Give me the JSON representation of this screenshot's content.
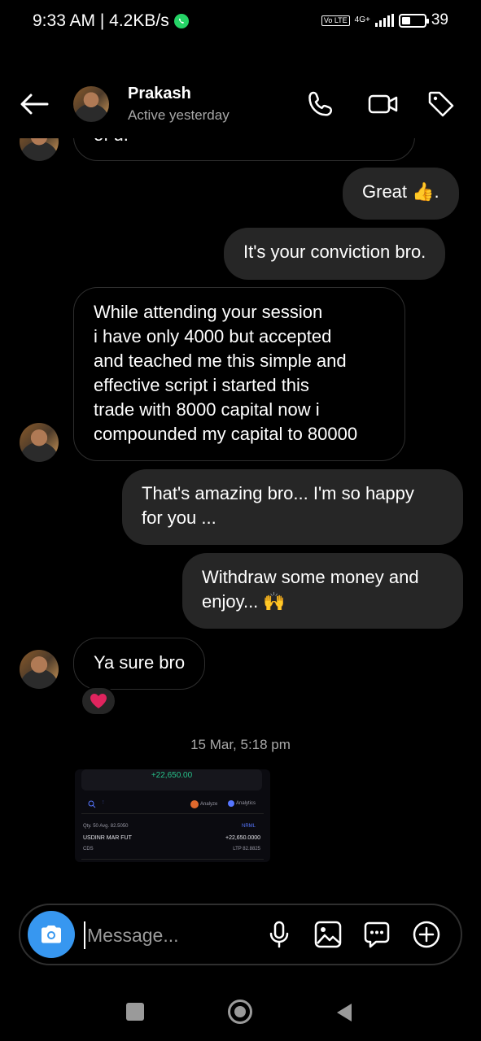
{
  "status": {
    "time_speed": "9:33 AM | 4.2KB/s",
    "volte": "Vo LTE",
    "network": "4G+",
    "battery": "39",
    "battery_level": 0.39
  },
  "header": {
    "name": "Prakash",
    "status": "Active yesterday"
  },
  "messages": [
    {
      "direction": "in",
      "text": "of u."
    },
    {
      "direction": "out",
      "text": "Great 👍."
    },
    {
      "direction": "out",
      "text": "It's your conviction bro."
    },
    {
      "direction": "in",
      "lines": [
        "While attending your session",
        "i have only 4000 but accepted",
        "and teached me this simple and",
        "effective script i started this",
        "trade with 8000 capital now i",
        "compounded my capital to 80000"
      ]
    },
    {
      "direction": "out",
      "lines": [
        "That's amazing bro... I'm so happy",
        "for you ..."
      ]
    },
    {
      "direction": "out",
      "lines": [
        "Withdraw some money and",
        "enjoy... 🙌"
      ]
    },
    {
      "direction": "in",
      "text": "Ya sure bro"
    }
  ],
  "reaction": "❤️",
  "timestamp": "15 Mar, 5:18 pm",
  "shared_image": {
    "pnl": "+22,650.00",
    "analyze": "Analyze",
    "analytics": "Analytics",
    "qty": "Qty. 50  Avg. 82.5050",
    "tag": "NRML",
    "symbol": "USDINR MAR FUT",
    "symbol_pnl": "+22,650.0000",
    "exchange": "CDS",
    "ltp": "LTP 82.8825"
  },
  "composer": {
    "placeholder": "Message..."
  },
  "icons": {
    "back": "back-arrow-icon",
    "call": "phone-icon",
    "video": "video-icon",
    "tag": "tag-icon",
    "camera": "camera-icon",
    "mic": "microphone-icon",
    "gallery": "gallery-icon",
    "sticker": "sticker-icon",
    "add": "plus-icon"
  },
  "colors": {
    "accent": "#3797f0",
    "bubble_out": "#262626",
    "whatsapp": "#25d366",
    "heart": "#e0245e"
  }
}
